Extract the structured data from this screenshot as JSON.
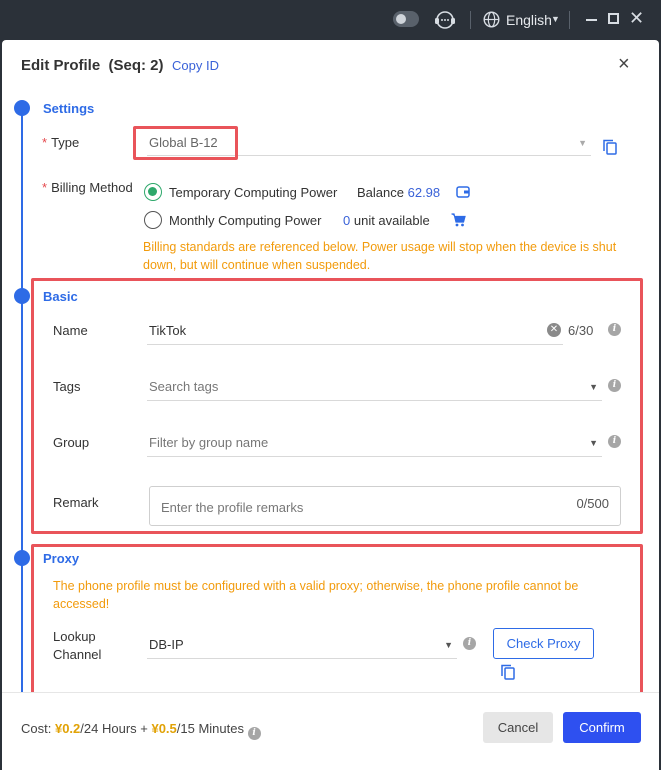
{
  "topbar": {
    "language": "English",
    "icons": [
      "theme-toggle-icon",
      "support-icon",
      "globe-icon",
      "minimize-icon",
      "maximize-icon",
      "close-icon"
    ]
  },
  "modal": {
    "title": "Edit Profile  (Seq: 2)",
    "copy_id": "Copy ID",
    "close": "×"
  },
  "settings": {
    "title": "Settings",
    "type_label": "Type",
    "type_value": "Global B-12",
    "billing_label": "Billing Method",
    "option_temp": "Temporary Computing Power",
    "balance_label": "Balance",
    "balance_value": "62.98",
    "option_monthly": "Monthly Computing Power",
    "unit_count": "0",
    "unit_label": "unit available",
    "billing_note": "Billing standards are referenced below. Power usage will stop when the device is shut down, but will continue when suspended."
  },
  "basic": {
    "title": "Basic",
    "name_label": "Name",
    "name_value": "TikTok",
    "name_count": "6/30",
    "tags_label": "Tags",
    "tags_placeholder": "Search tags",
    "group_label": "Group",
    "group_placeholder": "Filter by group name",
    "remark_label": "Remark",
    "remark_placeholder": "Enter the profile remarks",
    "remark_count": "0/500"
  },
  "proxy": {
    "title": "Proxy",
    "warning": "The phone profile must be configured with a valid proxy; otherwise, the phone profile cannot be accessed!",
    "lookup_label": "Lookup Channel",
    "lookup_value": "DB-IP",
    "check_proxy": "Check Proxy"
  },
  "footer": {
    "cost_prefix": "Cost:",
    "price1": "¥0.2",
    "period1": "/24 Hours + ",
    "price2": "¥0.5",
    "period2": "/15 Minutes",
    "cancel": "Cancel",
    "confirm": "Confirm"
  },
  "colors": {
    "accent": "#2e6be6",
    "primary_button": "#2e50f0",
    "warning": "#f29b0c",
    "highlight_box": "#e9545a",
    "selected_radio": "#2ea86b",
    "price": "#e1a206"
  }
}
